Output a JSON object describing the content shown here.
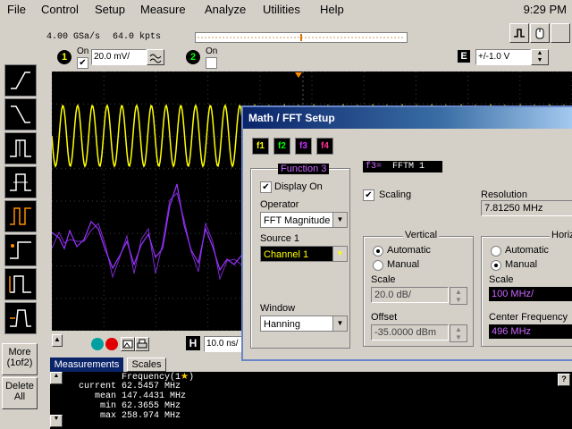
{
  "menu": {
    "items": [
      "File",
      "Control",
      "Setup",
      "Measure",
      "Analyze",
      "Utilities",
      "Help"
    ],
    "clock": "9:29 PM"
  },
  "acquisition": {
    "sample_rate": "4.00 GSa/s",
    "memory": "64.0 kpts"
  },
  "channel1": {
    "number": "1",
    "on_label": "On",
    "scale": "20.0 mV/"
  },
  "channel2": {
    "number": "2",
    "on_label": "On"
  },
  "trigger": {
    "e_label": "E",
    "level": "+/-1.0 V"
  },
  "left_buttons": {
    "more_label": "More",
    "more_sub": "(1of2)",
    "delete_label": "Delete",
    "delete_sub": "All"
  },
  "timebase": {
    "h_label": "H",
    "value": "10.0 ns/"
  },
  "dialog": {
    "title": "Math / FFT Setup",
    "func_buttons": [
      "f1",
      "f2",
      "f3",
      "f4"
    ],
    "function_group_title": "Function 3",
    "display_on_label": "Display On",
    "operator_label": "Operator",
    "operator_value": "FFT Magnitude",
    "source1_label": "Source 1",
    "source1_value": "Channel 1",
    "window_label": "Window",
    "window_value": "Hanning",
    "function_label": "f3=",
    "function_name": "FFTM   1",
    "scaling_label": "Scaling",
    "resolution_label": "Resolution",
    "resolution_value": "7.81250 MHz",
    "vertical": {
      "title": "Vertical",
      "automatic": "Automatic",
      "manual": "Manual",
      "scale_label": "Scale",
      "scale_value": "20.0 dB/",
      "offset_label": "Offset",
      "offset_value": "-35.0000 dBm"
    },
    "horizontal": {
      "title": "Horizo",
      "automatic": "Automatic",
      "manual": "Manual",
      "scale_label": "Scale",
      "scale_value": "100 MHz/",
      "center_label": "Center Frequency",
      "center_value": "496 MHz"
    }
  },
  "measurements": {
    "tabs": [
      "Measurements",
      "Scales"
    ],
    "header": "Frequency(1",
    "header_marker": "★",
    "header_close": ")",
    "help": "?",
    "rows": [
      {
        "label": "current",
        "value": "62.5457 MHz"
      },
      {
        "label": "mean",
        "value": "147.4431 MHz"
      },
      {
        "label": "min",
        "value": "62.3655 MHz"
      },
      {
        "label": "max",
        "value": "258.974 MHz"
      }
    ]
  },
  "colors": {
    "ch1": "#ffff00",
    "fft": "#9933ff",
    "accent": "#0a246a"
  }
}
